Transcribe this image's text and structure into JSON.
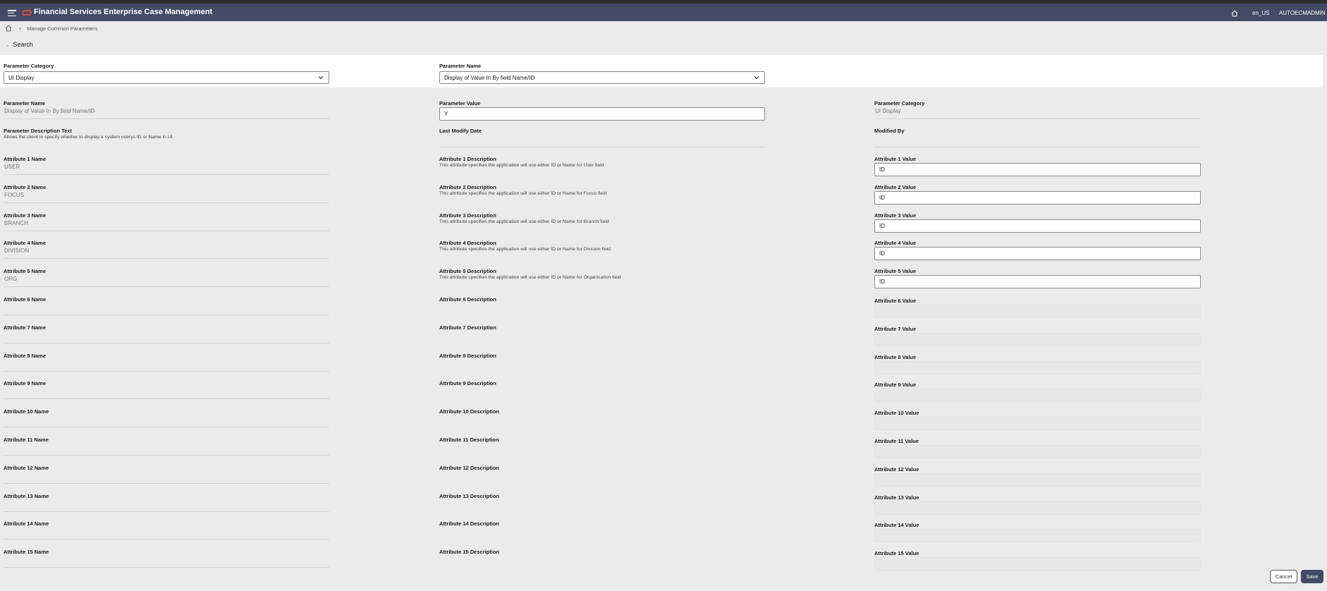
{
  "header": {
    "app_title": "Financial Services Enterprise Case Management",
    "locale": "en_US",
    "user": "AUTOECMADMIN"
  },
  "breadcrumb": {
    "current": "Manage Common Parameters"
  },
  "search": {
    "label": "Search",
    "category_label": "Parameter Category",
    "category_value": "UI Display",
    "name_label": "Parameter Name",
    "name_value": "Display of Value In By field Name/ID"
  },
  "details": {
    "param_name_label": "Parameter Name",
    "param_name_value": "Display of Value In By field Name/ID",
    "param_value_label": "Parameter Value",
    "param_value_value": "Y",
    "param_category_label": "Parameter Category",
    "param_category_value": "UI Display",
    "desc_text_label": "Parameter Description Text",
    "desc_text_value": "Allows the client to specify whether to display a system userys ID or Name in UI.",
    "last_modify_label": "Last Modify Date",
    "last_modify_value": "",
    "modified_by_label": "Modified By",
    "modified_by_value": ""
  },
  "attributes": [
    {
      "name_label": "Attribute 1 Name",
      "name": "USER",
      "desc_label": "Attribute 1 Description",
      "desc": "This attribute specifies the application will use either ID or Name for User field",
      "value_label": "Attribute 1 Value",
      "value": "ID"
    },
    {
      "name_label": "Attribute 2 Name",
      "name": "FOCUS",
      "desc_label": "Attribute 2 Description",
      "desc": "This attribute specifies the application will use either ID or Name for Focus field",
      "value_label": "Attribute 2 Value",
      "value": "ID"
    },
    {
      "name_label": "Attribute 3 Name",
      "name": "BRANCH",
      "desc_label": "Attribute 3 Description",
      "desc": "This attribute specifies the application will use either ID or Name for Branch field",
      "value_label": "Attribute 3 Value",
      "value": "ID"
    },
    {
      "name_label": "Attribute 4 Name",
      "name": "DIVISION",
      "desc_label": "Attribute 4 Description",
      "desc": "This attribute specifies the application will use either ID or Name for Division field",
      "value_label": "Attribute 4 Value",
      "value": "ID"
    },
    {
      "name_label": "Attribute 5 Name",
      "name": "ORG",
      "desc_label": "Attribute 5 Description",
      "desc": "This attribute specifies the application will use either ID or Name for Organisation field",
      "value_label": "Attribute 5 Value",
      "value": "ID"
    },
    {
      "name_label": "Attribute 6 Name",
      "name": "",
      "desc_label": "Attribute 6 Description",
      "desc": "",
      "value_label": "Attribute 6 Value",
      "value": ""
    },
    {
      "name_label": "Attribute 7 Name",
      "name": "",
      "desc_label": "Attribute 7 Description",
      "desc": "",
      "value_label": "Attribute 7 Value",
      "value": ""
    },
    {
      "name_label": "Attribute 8 Name",
      "name": "",
      "desc_label": "Attribute 8 Description",
      "desc": "",
      "value_label": "Attribute 8 Value",
      "value": ""
    },
    {
      "name_label": "Attribute 9 Name",
      "name": "",
      "desc_label": "Attribute 9 Description",
      "desc": "",
      "value_label": "Attribute 9 Value",
      "value": ""
    },
    {
      "name_label": "Attribute 10 Name",
      "name": "",
      "desc_label": "Attribute 10 Description",
      "desc": "",
      "value_label": "Attribute 10 Value",
      "value": ""
    },
    {
      "name_label": "Attribute 11 Name",
      "name": "",
      "desc_label": "Attribute 11 Description",
      "desc": "",
      "value_label": "Attribute 11 Value",
      "value": ""
    },
    {
      "name_label": "Attribute 12 Name",
      "name": "",
      "desc_label": "Attribute 12 Description",
      "desc": "",
      "value_label": "Attribute 12 Value",
      "value": ""
    },
    {
      "name_label": "Attribute 13 Name",
      "name": "",
      "desc_label": "Attribute 13 Description",
      "desc": "",
      "value_label": "Attribute 13 Value",
      "value": ""
    },
    {
      "name_label": "Attribute 14 Name",
      "name": "",
      "desc_label": "Attribute 14 Description",
      "desc": "",
      "value_label": "Attribute 14 Value",
      "value": ""
    },
    {
      "name_label": "Attribute 15 Name",
      "name": "",
      "desc_label": "Attribute 15 Description",
      "desc": "",
      "value_label": "Attribute 15 Value",
      "value": ""
    }
  ],
  "actions": {
    "cancel": "Cancel",
    "save": "Save"
  }
}
